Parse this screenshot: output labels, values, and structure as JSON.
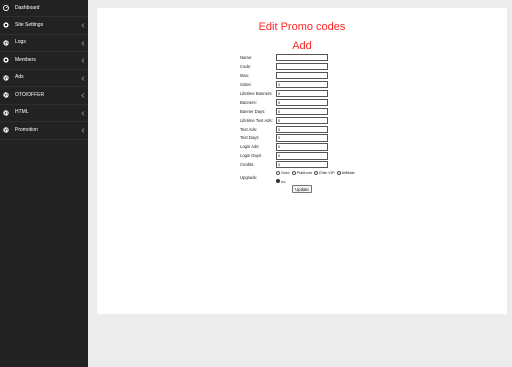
{
  "sidebar": {
    "items": [
      {
        "label": "Dashboard",
        "icon": "dashboard-icon",
        "has_chevron": false
      },
      {
        "label": "Site Settings",
        "icon": "gear-icon",
        "has_chevron": true
      },
      {
        "label": "Logs",
        "icon": "globe-icon",
        "has_chevron": true
      },
      {
        "label": "Members",
        "icon": "gear-icon",
        "has_chevron": true
      },
      {
        "label": "Ads",
        "icon": "globe-icon",
        "has_chevron": true
      },
      {
        "label": "OTO/OFFER",
        "icon": "globe-icon",
        "has_chevron": true
      },
      {
        "label": "HTML",
        "icon": "globe-icon",
        "has_chevron": true
      },
      {
        "label": "Promotion",
        "icon": "globe-icon",
        "has_chevron": true
      }
    ]
  },
  "main": {
    "title": "Edit Promo codes",
    "subtitle": "Add",
    "fields": [
      {
        "label": "Name:",
        "value": ""
      },
      {
        "label": "Code:",
        "value": ""
      },
      {
        "label": "Max:",
        "value": ""
      },
      {
        "label": "Solos:",
        "value": "0"
      },
      {
        "label": "Lifetime Banners:",
        "value": "0"
      },
      {
        "label": "Banners:",
        "value": "0"
      },
      {
        "label": "Banner Days:",
        "value": "0"
      },
      {
        "label": "Lifetime Text Ads:",
        "value": "0"
      },
      {
        "label": "Text Ads:",
        "value": "0"
      },
      {
        "label": "Text Days:",
        "value": "0"
      },
      {
        "label": "Login Ads:",
        "value": "0"
      },
      {
        "label": "Login Days:",
        "value": "0"
      },
      {
        "label": "Credits:",
        "value": "0"
      }
    ],
    "upgrade": {
      "label": "Upgrade:",
      "options": [
        "Gold",
        "Platinum",
        "Elite VIP",
        "Affiliate",
        "no"
      ],
      "selected": "no"
    },
    "update_label": "Update"
  },
  "colors": {
    "sidebar_bg": "#222222",
    "title_red": "#ff2424",
    "page_bg": "#ececec"
  }
}
